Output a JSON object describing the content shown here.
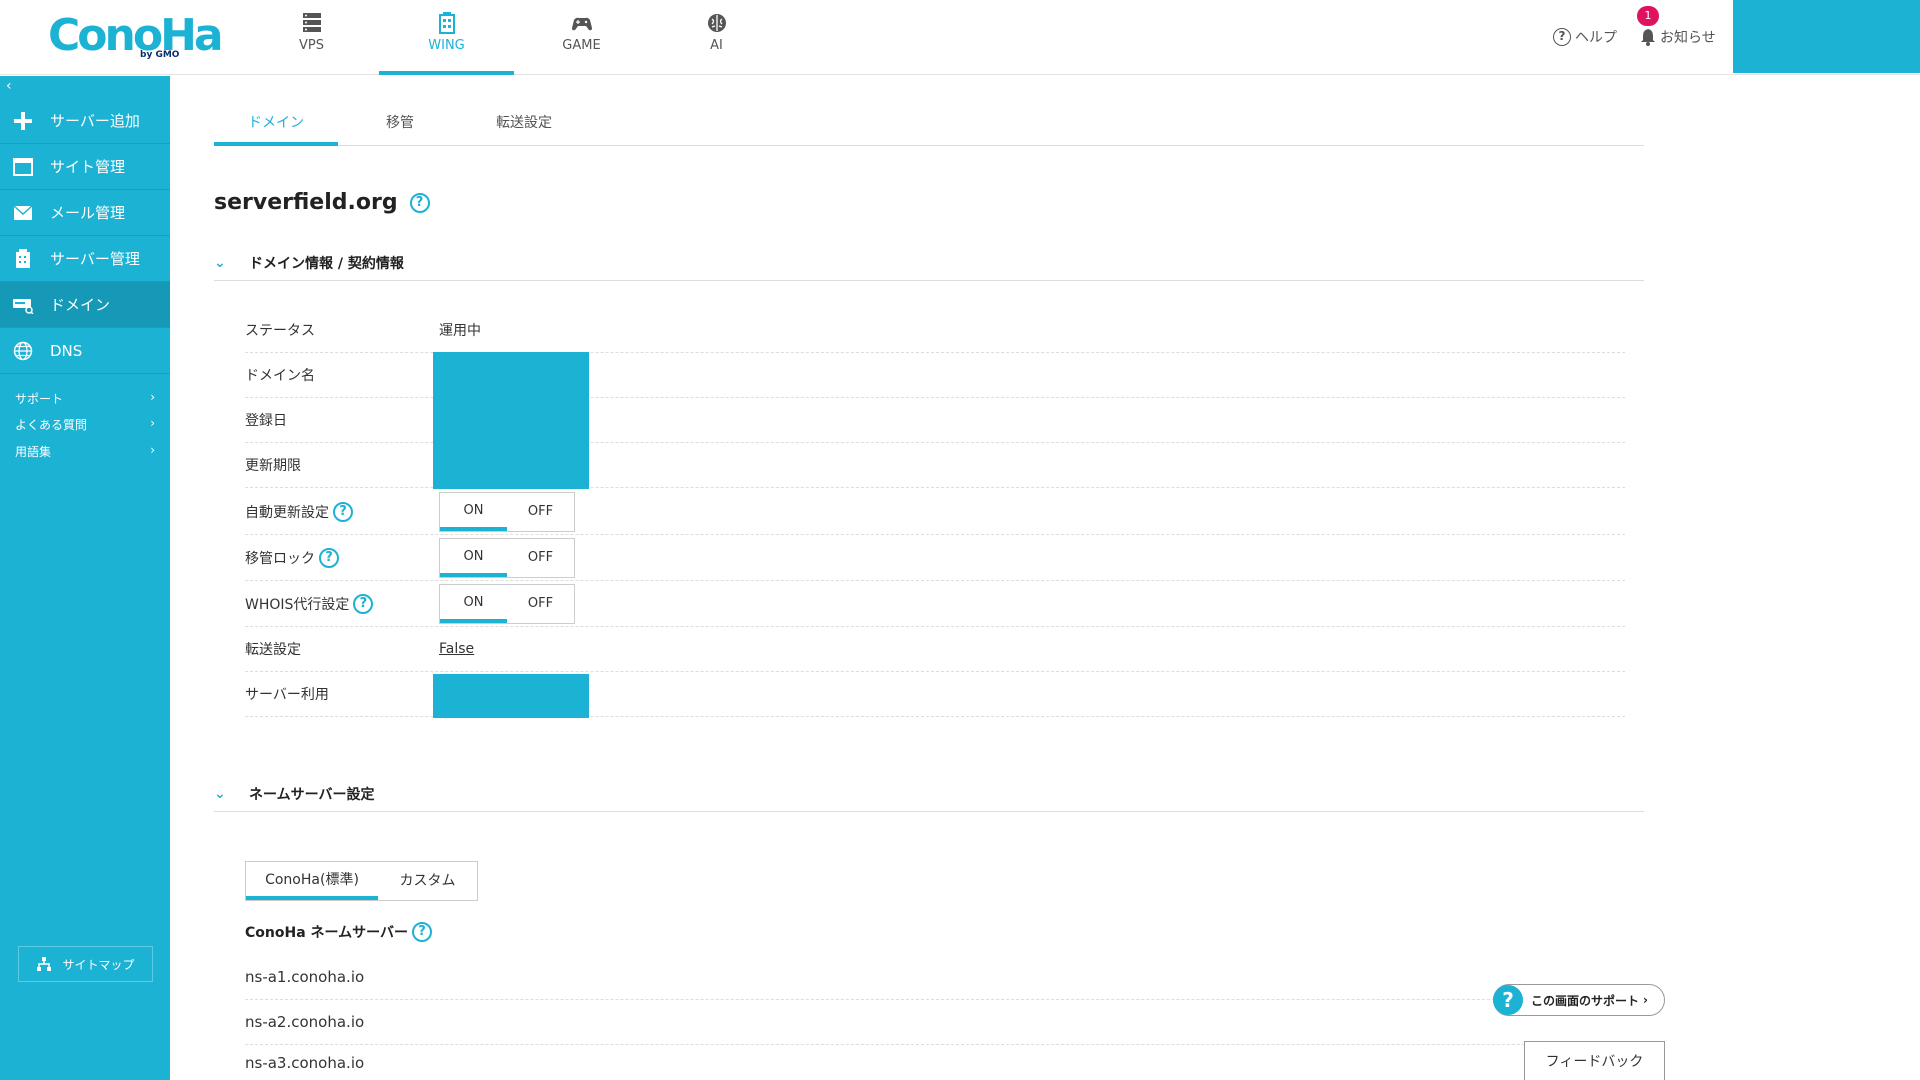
{
  "header": {
    "logo_text": "ConoHa",
    "logo_sub": "by GMO",
    "nav": [
      {
        "label": "VPS",
        "icon": "server-stack-icon"
      },
      {
        "label": "WING",
        "icon": "wing-building-icon"
      },
      {
        "label": "GAME",
        "icon": "gamepad-icon"
      },
      {
        "label": "AI",
        "icon": "brain-icon"
      }
    ],
    "help_label": "ヘルプ",
    "notice_label": "お知らせ",
    "notice_count": "1"
  },
  "sidebar": {
    "items": [
      {
        "label": "サーバー追加",
        "icon": "plus-icon"
      },
      {
        "label": "サイト管理",
        "icon": "window-icon"
      },
      {
        "label": "メール管理",
        "icon": "mail-icon"
      },
      {
        "label": "サーバー管理",
        "icon": "server-icon"
      },
      {
        "label": "ドメイン",
        "icon": "domain-icon"
      },
      {
        "label": "DNS",
        "icon": "globe-icon"
      }
    ],
    "sub_items": [
      {
        "label": "サポート"
      },
      {
        "label": "よくある質問"
      },
      {
        "label": "用語集"
      }
    ],
    "sitemap_label": "サイトマップ"
  },
  "tabs": [
    {
      "label": "ドメイン"
    },
    {
      "label": "移管"
    },
    {
      "label": "転送設定"
    }
  ],
  "page_title": "serverfield.org",
  "domain_section": {
    "title": "ドメイン情報 / 契約情報",
    "status_label": "ステータス",
    "status_value": "運用中",
    "domain_name_label": "ドメイン名",
    "registered_label": "登録日",
    "renewal_label": "更新期限",
    "auto_renew_label": "自動更新設定",
    "transfer_lock_label": "移管ロック",
    "whois_label": "WHOIS代行設定",
    "toggle_on": "ON",
    "toggle_off": "OFF",
    "forward_label": "転送設定",
    "forward_value": "False",
    "server_use_label": "サーバー利用"
  },
  "ns_section": {
    "title": "ネームサーバー設定",
    "tabs": [
      {
        "label": "ConoHa(標準)"
      },
      {
        "label": "カスタム"
      }
    ],
    "ns_title": "ConoHa ネームサーバー",
    "servers": [
      "ns-a1.conoha.io",
      "ns-a2.conoha.io",
      "ns-a3.conoha.io"
    ]
  },
  "support_label": "この画面のサポート",
  "feedback_label": "フィードバック",
  "colors": {
    "accent": "#1cb2d4",
    "badge": "#e0115f"
  }
}
